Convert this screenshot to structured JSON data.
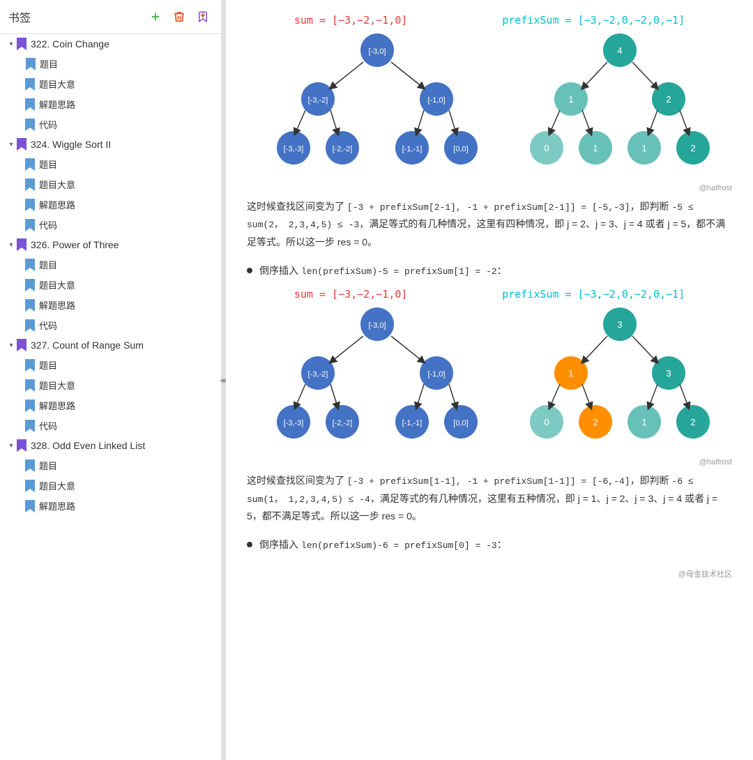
{
  "sidebar": {
    "title": "书签",
    "actions": [
      {
        "icon": "add",
        "label": "+"
      },
      {
        "icon": "close-red",
        "label": "✕"
      },
      {
        "icon": "bookmark-purple",
        "label": "🔖"
      }
    ],
    "sections": [
      {
        "id": "322",
        "label": "322. Coin Change",
        "expanded": true,
        "children": [
          "题目",
          "题目大意",
          "解题思路",
          "代码"
        ]
      },
      {
        "id": "324",
        "label": "324. Wiggle Sort II",
        "expanded": true,
        "children": [
          "题目",
          "题目大意",
          "解题思路",
          "代码"
        ]
      },
      {
        "id": "326",
        "label": "326. Power of Three",
        "expanded": true,
        "children": [
          "题目",
          "题目大意",
          "解题思路",
          "代码"
        ]
      },
      {
        "id": "327",
        "label": "327. Count of Range Sum",
        "expanded": true,
        "children": [
          "题目",
          "题目大意",
          "解题思路",
          "代码"
        ]
      },
      {
        "id": "328",
        "label": "328. Odd Even Linked List",
        "expanded": true,
        "children": [
          "题目",
          "题目大意",
          "解题思路"
        ]
      }
    ]
  },
  "main": {
    "diagram1": {
      "sum_label": "sum = [−3,−2,−1,0]",
      "prefix_label": "prefixSum = [−3,−2,0,−2,0,−1]",
      "watermark": "@halfrost"
    },
    "text1": "这时候查找区间变为了 [−3 + prefixSum[2−1], −1 + prefixSum[2−1]] = [−5,−3]，即判断 −5 ≤ sum(2，  2,3,4,5) ≤ −3，满足等式的有几种情况，这里有四种情况，即 j = 2、j = 3、j = 4 或者 j = 5，都不满足等式。所以这一步 res = 0。",
    "bullet1": "倒序插入 len(prefixSum)-5 = prefixSum[1] = −2：",
    "diagram2": {
      "sum_label": "sum = [−3,−2,−1,0]",
      "prefix_label": "prefixSum = [−3,−2,0,−2,0,−1]",
      "watermark": "@halfrost"
    },
    "text2": "这时候查找区间变为了 [−3 + prefixSum[1−1], −1 + prefixSum[1−1]] = [−6,−4]，即判断 −6 ≤ sum(1，  1,2,3,4,5) ≤ −4，满足等式的有几种情况，这里有五种情况，即 j = 1、j = 2、j = 3、j = 4 或者 j = 5，都不满足等式。所以这一步 res = 0。",
    "bullet2": "倒序插入 len(prefixSum)-6 = prefixSum[0] = −3：",
    "watermark2": "@母金技术社区"
  }
}
